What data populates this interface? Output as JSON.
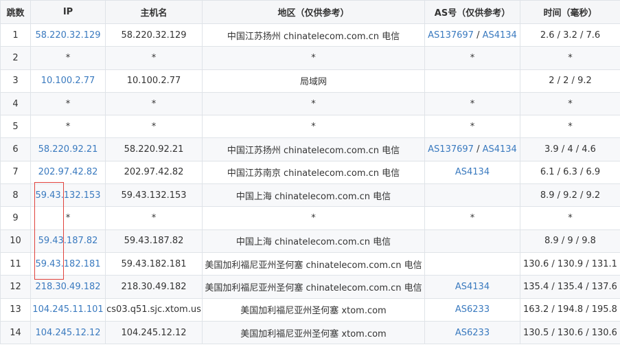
{
  "headers": {
    "hop": "跳数",
    "ip": "IP",
    "host": "主机名",
    "region": "地区（仅供参考）",
    "asn": "AS号（仅供参考）",
    "time": "时间（毫秒）"
  },
  "rows": [
    {
      "hop": "1",
      "ip": "58.220.32.129",
      "host": "58.220.32.129",
      "region": "中国江苏扬州 chinatelecom.com.cn 电信",
      "asn": [
        "AS137697",
        "AS4134"
      ],
      "time": "2.6 / 3.2 / 7.6"
    },
    {
      "hop": "2",
      "ip": "*",
      "host": "*",
      "region": "*",
      "asn": [
        "*"
      ],
      "time": "*"
    },
    {
      "hop": "3",
      "ip": "10.100.2.77",
      "host": "10.100.2.77",
      "region": "局域网",
      "asn": [],
      "time": "2 / 2 / 9.2"
    },
    {
      "hop": "4",
      "ip": "*",
      "host": "*",
      "region": "*",
      "asn": [
        "*"
      ],
      "time": "*"
    },
    {
      "hop": "5",
      "ip": "*",
      "host": "*",
      "region": "*",
      "asn": [
        "*"
      ],
      "time": "*"
    },
    {
      "hop": "6",
      "ip": "58.220.92.21",
      "host": "58.220.92.21",
      "region": "中国江苏扬州 chinatelecom.com.cn 电信",
      "asn": [
        "AS137697",
        "AS4134"
      ],
      "time": "3.9 / 4 / 4.6"
    },
    {
      "hop": "7",
      "ip": "202.97.42.82",
      "host": "202.97.42.82",
      "region": "中国江苏南京 chinatelecom.com.cn 电信",
      "asn": [
        "AS4134"
      ],
      "time": "6.1 / 6.3 / 6.9"
    },
    {
      "hop": "8",
      "ip": "59.43.132.153",
      "host": "59.43.132.153",
      "region": "中国上海 chinatelecom.com.cn 电信",
      "asn": [],
      "time": "8.9 / 9.2 / 9.2"
    },
    {
      "hop": "9",
      "ip": "*",
      "host": "*",
      "region": "*",
      "asn": [
        "*"
      ],
      "time": "*"
    },
    {
      "hop": "10",
      "ip": "59.43.187.82",
      "host": "59.43.187.82",
      "region": "中国上海 chinatelecom.com.cn 电信",
      "asn": [],
      "time": "8.9 / 9 / 9.8"
    },
    {
      "hop": "11",
      "ip": "59.43.182.181",
      "host": "59.43.182.181",
      "region": "美国加利福尼亚州圣何塞 chinatelecom.com.cn 电信",
      "asn": [],
      "time": "130.6 / 130.9 / 131.1"
    },
    {
      "hop": "12",
      "ip": "218.30.49.182",
      "host": "218.30.49.182",
      "region": "美国加利福尼亚州圣何塞 chinatelecom.com.cn 电信",
      "asn": [
        "AS4134"
      ],
      "time": "135.4 / 135.4 / 137.6"
    },
    {
      "hop": "13",
      "ip": "104.245.11.101",
      "host": "cs03.q51.sjc.xtom.us",
      "region": "美国加利福尼亚州圣何塞 xtom.com",
      "asn": [
        "AS6233"
      ],
      "time": "163.2 / 194.8 / 195.8"
    },
    {
      "hop": "14",
      "ip": "104.245.12.12",
      "host": "104.245.12.12",
      "region": "美国加利福尼亚州圣何塞 xtom.com",
      "asn": [
        "AS6233"
      ],
      "time": "130.5 / 130.6 / 130.6"
    }
  ],
  "asn_separator": " / ",
  "colors": {
    "link": "#3a7abf",
    "border": "#dfe3e8",
    "header_bg": "#f5f6f8",
    "highlight": "#e0403a"
  }
}
